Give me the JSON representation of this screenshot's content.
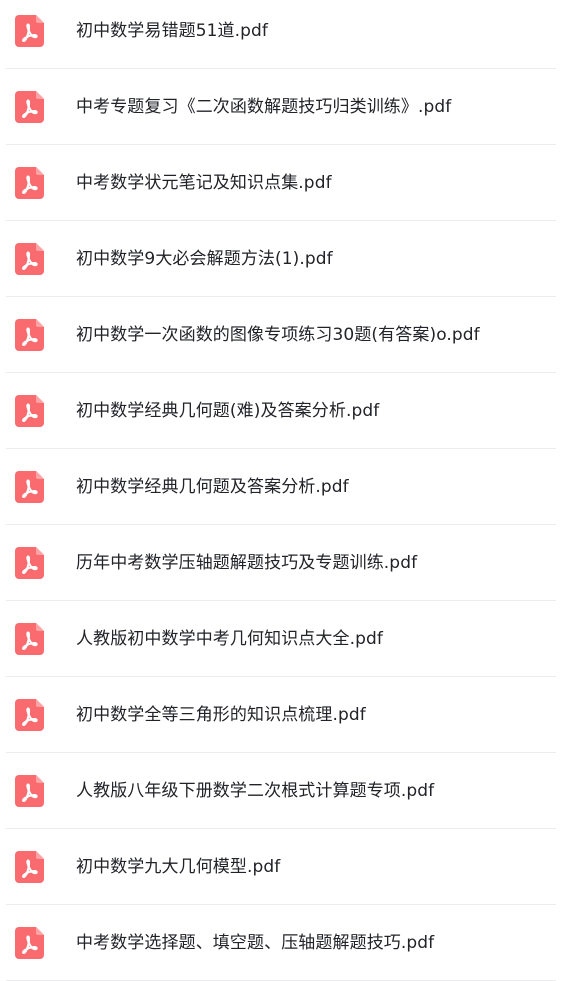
{
  "file_list": {
    "icon": "pdf-file-icon",
    "icon_color": "#fa6b6f",
    "items": [
      {
        "name": "初中数学易错题51道.pdf"
      },
      {
        "name": "中考专题复习《二次函数解题技巧归类训练》.pdf"
      },
      {
        "name": "中考数学状元笔记及知识点集.pdf"
      },
      {
        "name": "初中数学9大必会解题方法(1).pdf"
      },
      {
        "name": "初中数学一次函数的图像专项练习30题(有答案)o.pdf"
      },
      {
        "name": "初中数学经典几何题(难)及答案分析.pdf"
      },
      {
        "name": "初中数学经典几何题及答案分析.pdf"
      },
      {
        "name": "历年中考数学压轴题解题技巧及专题训练.pdf"
      },
      {
        "name": "人教版初中数学中考几何知识点大全.pdf"
      },
      {
        "name": "初中数学全等三角形的知识点梳理.pdf"
      },
      {
        "name": "人教版八年级下册数学二次根式计算题专项.pdf"
      },
      {
        "name": "初中数学九大几何模型.pdf"
      },
      {
        "name": "中考数学选择题、填空题、压轴题解题技巧.pdf"
      }
    ]
  }
}
